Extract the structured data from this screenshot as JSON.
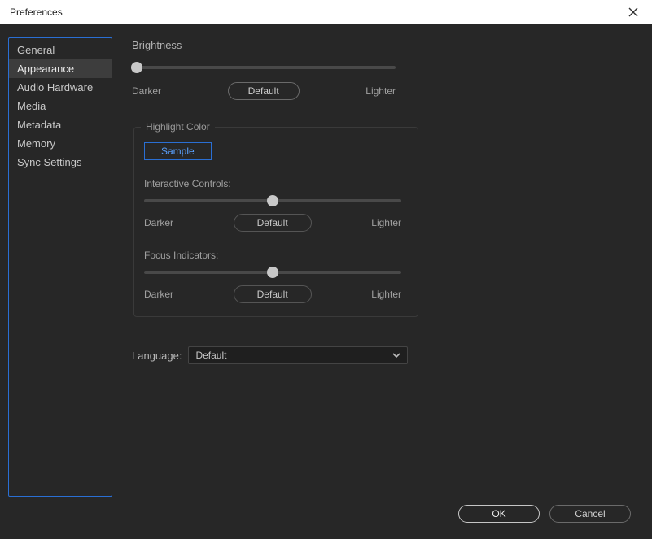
{
  "window": {
    "title": "Preferences"
  },
  "sidebar": {
    "items": [
      {
        "label": "General",
        "selected": false
      },
      {
        "label": "Appearance",
        "selected": true
      },
      {
        "label": "Audio Hardware",
        "selected": false
      },
      {
        "label": "Media",
        "selected": false
      },
      {
        "label": "Metadata",
        "selected": false
      },
      {
        "label": "Memory",
        "selected": false
      },
      {
        "label": "Sync Settings",
        "selected": false
      }
    ]
  },
  "brightness": {
    "label": "Brightness",
    "min_label": "Darker",
    "max_label": "Lighter",
    "default_label": "Default",
    "position_pct": 2
  },
  "highlight": {
    "legend": "Highlight Color",
    "sample_label": "Sample",
    "interactive": {
      "label": "Interactive Controls:",
      "min_label": "Darker",
      "max_label": "Lighter",
      "default_label": "Default",
      "position_pct": 50
    },
    "focus": {
      "label": "Focus Indicators:",
      "min_label": "Darker",
      "max_label": "Lighter",
      "default_label": "Default",
      "position_pct": 50
    }
  },
  "language": {
    "label": "Language:",
    "value": "Default"
  },
  "buttons": {
    "ok": "OK",
    "cancel": "Cancel"
  }
}
